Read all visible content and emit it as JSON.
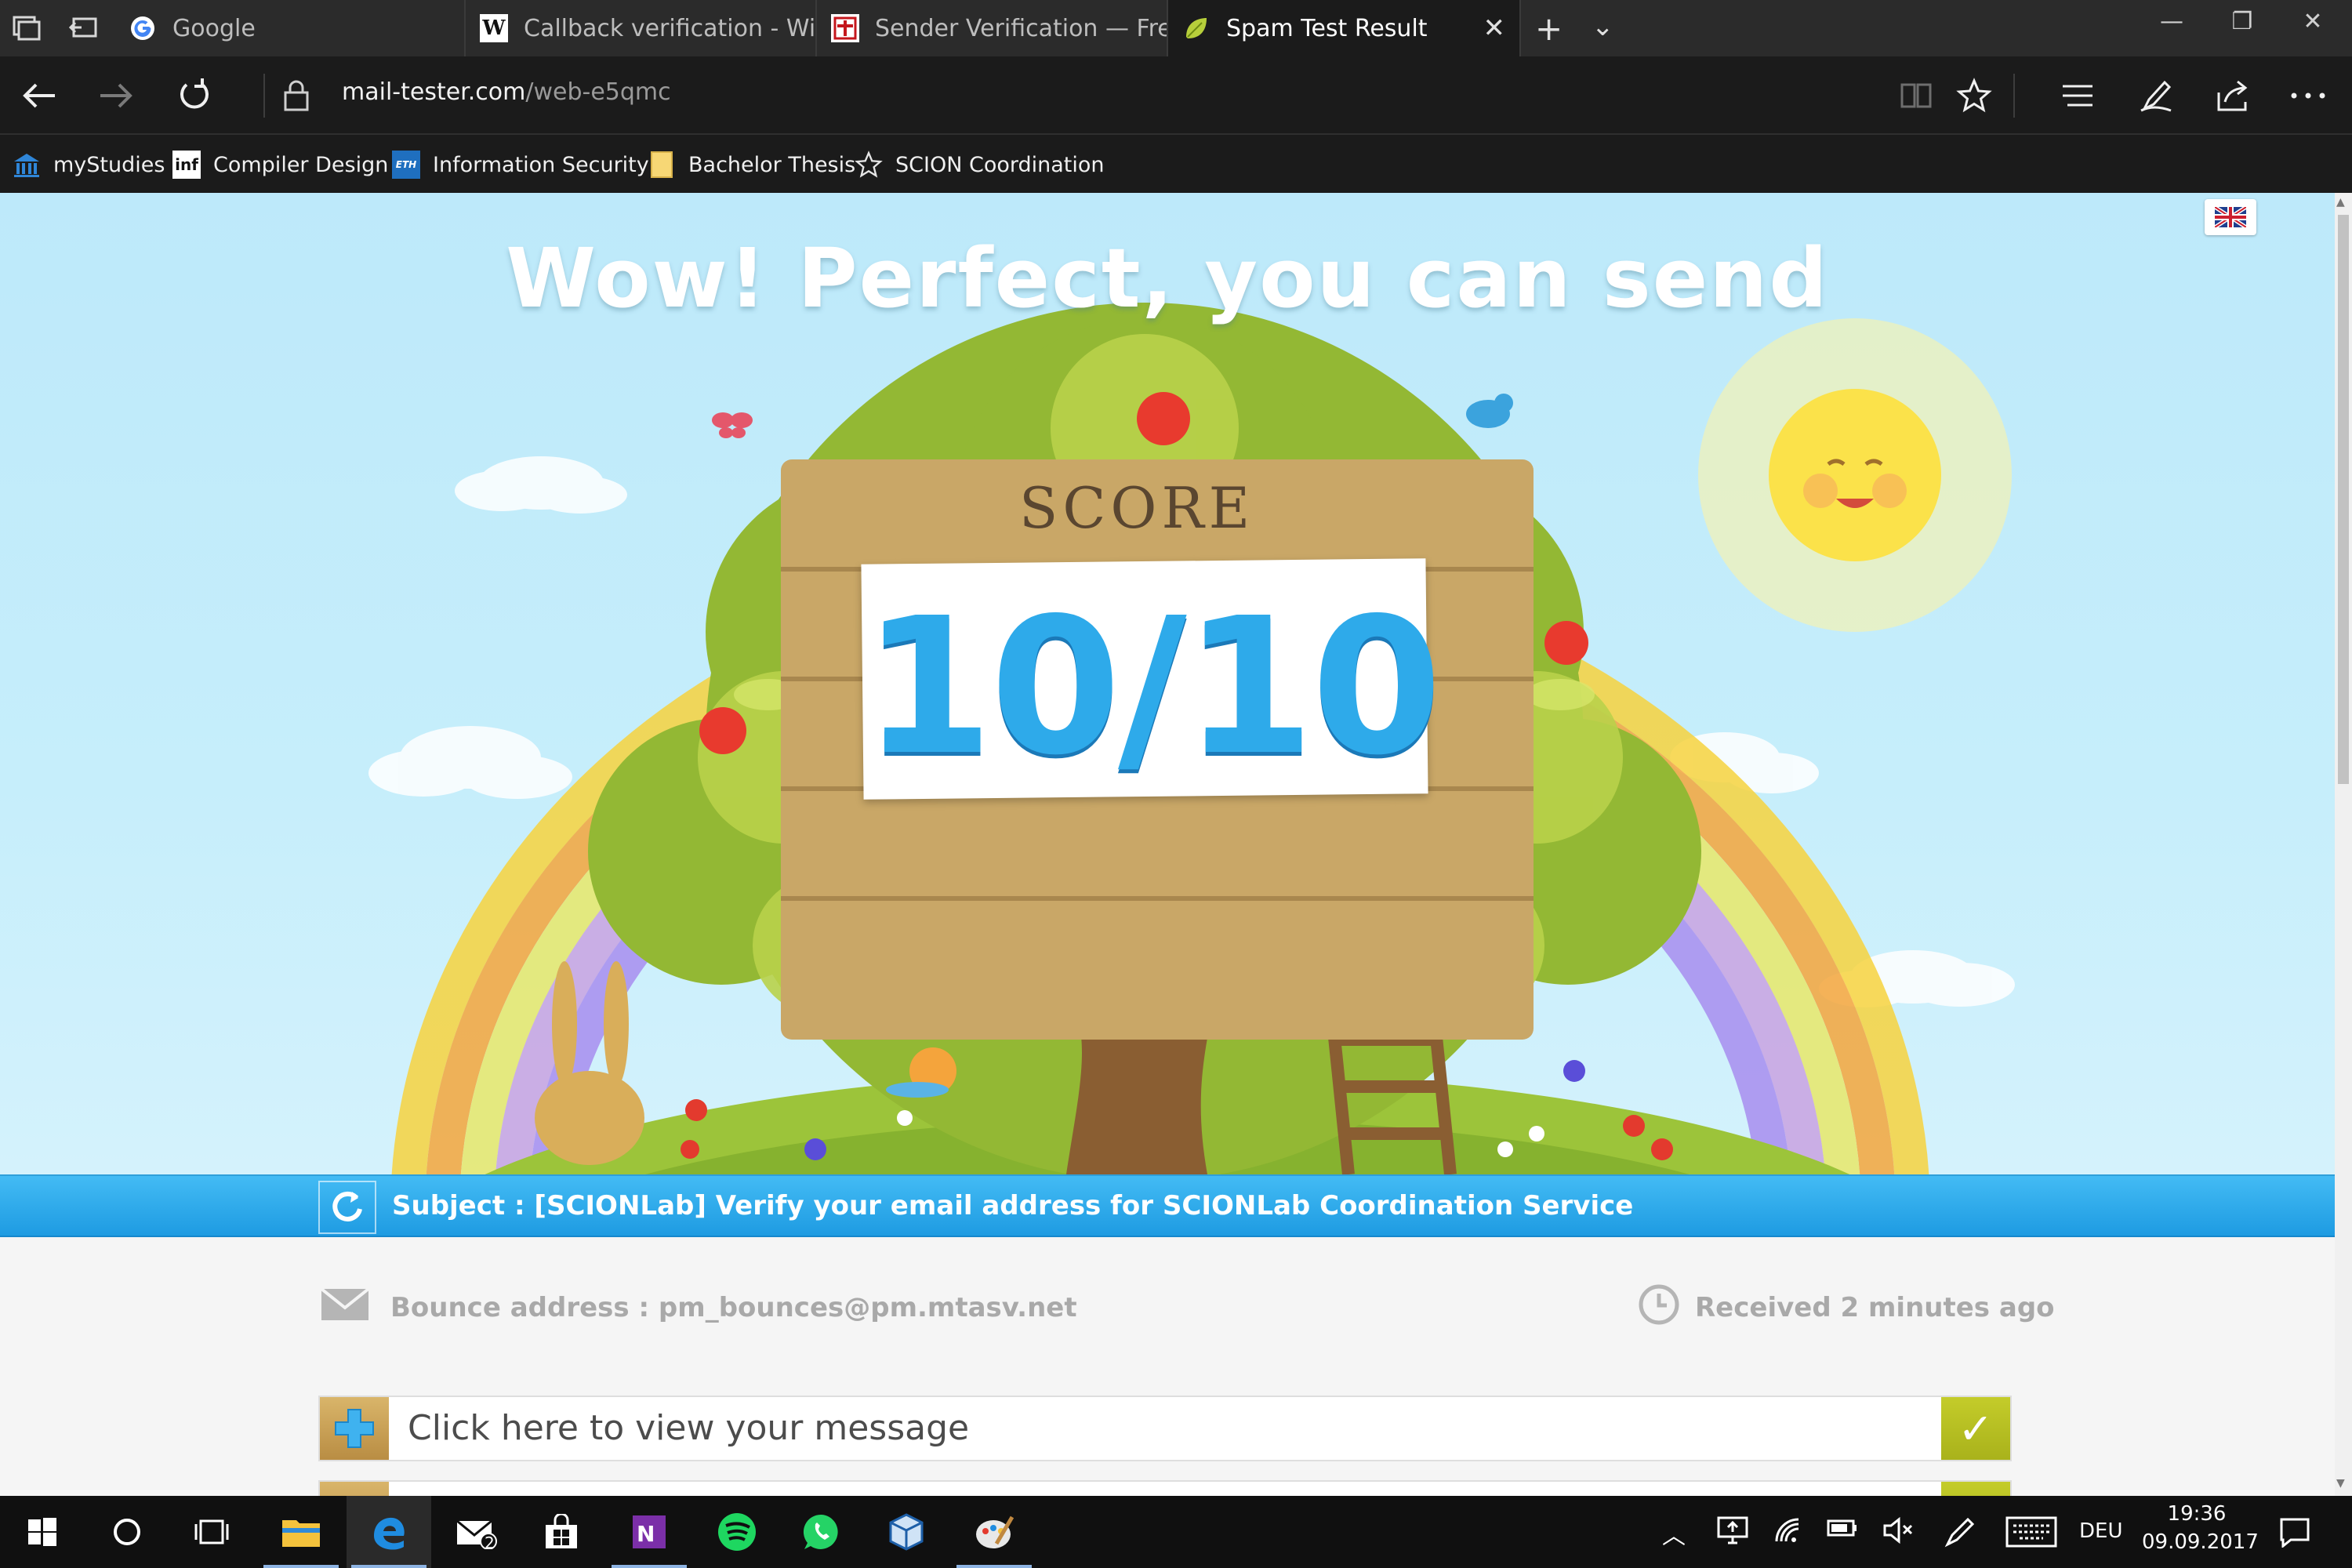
{
  "browser": {
    "tabs": [
      {
        "title": "Google",
        "icon": "google-icon"
      },
      {
        "title": "Callback verification - Wikip",
        "icon": "wikipedia-icon"
      },
      {
        "title": "Sender Verification — Free !",
        "icon": "sender-favicon"
      },
      {
        "title": "Spam Test Result",
        "icon": "leaf-favicon",
        "active": true
      }
    ],
    "url_host": "mail-tester.com",
    "url_path": "/web-e5qmc",
    "favorites": [
      {
        "label": "myStudies",
        "icon": "building-icon"
      },
      {
        "label": "Compiler Design",
        "icon": "inf-icon"
      },
      {
        "label": "Information Security",
        "icon": "eth-icon"
      },
      {
        "label": "Bachelor Thesis",
        "icon": "folder-icon"
      },
      {
        "label": "SCION Coordination",
        "icon": "star-icon"
      }
    ]
  },
  "page": {
    "headline": "Wow! Perfect, you can send",
    "score_label": "SCORE :",
    "score": "10/10",
    "subject": "Subject : [SCIONLab] Verify your email address for SCIONLab Coordination Service",
    "bounce": "Bounce address : pm_bounces@pm.mtasv.net",
    "received": "Received 2 minutes ago",
    "view_message": "Click here to view your message"
  },
  "taskbar": {
    "language": "DEU",
    "time": "19:36",
    "date": "09.09.2017",
    "mail_badge": "2"
  },
  "colors": {
    "accent_blue": "#2eaaea",
    "check_green": "#b5bd22",
    "sky": "#bde9fa"
  }
}
